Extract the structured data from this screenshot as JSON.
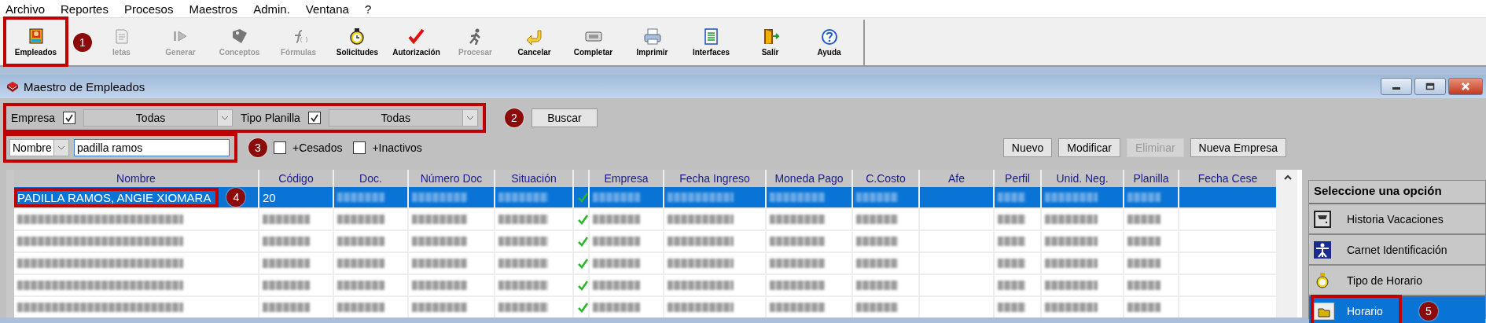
{
  "menu": [
    "Archivo",
    "Reportes",
    "Procesos",
    "Maestros",
    "Admin.",
    "Ventana",
    "?"
  ],
  "toolbar": [
    {
      "label": "Empleados",
      "disabled": false,
      "callout": "1"
    },
    {
      "label": "letas",
      "disabled": true
    },
    {
      "label": "Generar",
      "disabled": true
    },
    {
      "label": "Conceptos",
      "disabled": true
    },
    {
      "label": "Fórmulas",
      "disabled": true
    },
    {
      "label": "Solicitudes",
      "disabled": false
    },
    {
      "label": "Autorización",
      "disabled": false
    },
    {
      "label": "Procesar",
      "disabled": true
    },
    {
      "label": "Cancelar",
      "disabled": false
    },
    {
      "label": "Completar",
      "disabled": false
    },
    {
      "label": "Imprimir",
      "disabled": false
    },
    {
      "label": "Interfaces",
      "disabled": false
    },
    {
      "label": "Salir",
      "disabled": false
    },
    {
      "label": "Ayuda",
      "disabled": false
    }
  ],
  "window": {
    "title": "Maestro de Empleados"
  },
  "filters": {
    "callout": "2",
    "empresa": {
      "label": "Empresa",
      "checked": true,
      "value": "Todas"
    },
    "tipo_planilla": {
      "label": "Tipo Planilla",
      "checked": true,
      "value": "Todas"
    },
    "search_button": "Buscar"
  },
  "search": {
    "callout": "3",
    "field": "Nombre",
    "value": "padilla ramos",
    "options": [
      {
        "label": "+Cesados",
        "checked": false
      },
      {
        "label": "+Inactivos",
        "checked": false
      }
    ]
  },
  "actions": [
    {
      "label": "Nuevo",
      "disabled": false
    },
    {
      "label": "Modificar",
      "disabled": false
    },
    {
      "label": "Eliminar",
      "disabled": true
    },
    {
      "label": "Nueva Empresa",
      "disabled": false
    }
  ],
  "table": {
    "columns": [
      {
        "kind": "text",
        "label": "Nombre"
      },
      {
        "kind": "text",
        "label": "Código"
      },
      {
        "kind": "text",
        "label": "Doc."
      },
      {
        "kind": "text",
        "label": "Número Doc"
      },
      {
        "kind": "text",
        "label": "Situación"
      },
      {
        "kind": "status"
      },
      {
        "kind": "text",
        "label": "Empresa"
      },
      {
        "kind": "text",
        "label": "Fecha Ingreso"
      },
      {
        "kind": "text",
        "label": "Moneda Pago"
      },
      {
        "kind": "text",
        "label": "C.Costo"
      },
      {
        "kind": "text",
        "label": "Afe"
      },
      {
        "kind": "text",
        "label": "Perfil"
      },
      {
        "kind": "text",
        "label": "Unid. Neg."
      },
      {
        "kind": "text",
        "label": "Planilla"
      },
      {
        "kind": "text",
        "label": "Fecha Cese"
      }
    ],
    "rows": [
      {
        "selected": true,
        "cells": [
          {
            "kind": "text",
            "text": "PADILLA RAMOS, ANGIE XIOMARA",
            "callout": "4"
          },
          {
            "kind": "text",
            "text": "20"
          },
          {
            "kind": "blurred"
          },
          {
            "kind": "blurred"
          },
          {
            "kind": "blurred"
          },
          {
            "kind": "check",
            "checked": true
          },
          {
            "kind": "blurred"
          },
          {
            "kind": "blurred"
          },
          {
            "kind": "blurred"
          },
          {
            "kind": "blurred"
          },
          {
            "kind": "empty"
          },
          {
            "kind": "blurred"
          },
          {
            "kind": "blurred"
          },
          {
            "kind": "blurred"
          },
          {
            "kind": "empty"
          }
        ]
      },
      {
        "selected": false,
        "cells": [
          {
            "kind": "blurred"
          },
          {
            "kind": "blurred"
          },
          {
            "kind": "blurred"
          },
          {
            "kind": "blurred"
          },
          {
            "kind": "blurred"
          },
          {
            "kind": "check",
            "checked": true
          },
          {
            "kind": "blurred"
          },
          {
            "kind": "blurred"
          },
          {
            "kind": "blurred"
          },
          {
            "kind": "blurred"
          },
          {
            "kind": "empty"
          },
          {
            "kind": "blurred"
          },
          {
            "kind": "blurred"
          },
          {
            "kind": "blurred"
          },
          {
            "kind": "empty"
          }
        ]
      },
      {
        "selected": false,
        "cells": [
          {
            "kind": "blurred"
          },
          {
            "kind": "blurred"
          },
          {
            "kind": "blurred"
          },
          {
            "kind": "blurred"
          },
          {
            "kind": "blurred"
          },
          {
            "kind": "check",
            "checked": true
          },
          {
            "kind": "blurred"
          },
          {
            "kind": "blurred"
          },
          {
            "kind": "blurred"
          },
          {
            "kind": "blurred"
          },
          {
            "kind": "empty"
          },
          {
            "kind": "blurred"
          },
          {
            "kind": "blurred"
          },
          {
            "kind": "blurred"
          },
          {
            "kind": "empty"
          }
        ]
      },
      {
        "selected": false,
        "cells": [
          {
            "kind": "blurred"
          },
          {
            "kind": "blurred"
          },
          {
            "kind": "blurred"
          },
          {
            "kind": "blurred"
          },
          {
            "kind": "blurred"
          },
          {
            "kind": "check",
            "checked": true
          },
          {
            "kind": "blurred"
          },
          {
            "kind": "blurred"
          },
          {
            "kind": "blurred"
          },
          {
            "kind": "blurred"
          },
          {
            "kind": "empty"
          },
          {
            "kind": "blurred"
          },
          {
            "kind": "blurred"
          },
          {
            "kind": "blurred"
          },
          {
            "kind": "empty"
          }
        ]
      },
      {
        "selected": false,
        "cells": [
          {
            "kind": "blurred"
          },
          {
            "kind": "blurred"
          },
          {
            "kind": "blurred"
          },
          {
            "kind": "blurred"
          },
          {
            "kind": "blurred"
          },
          {
            "kind": "check",
            "checked": true
          },
          {
            "kind": "blurred"
          },
          {
            "kind": "blurred"
          },
          {
            "kind": "blurred"
          },
          {
            "kind": "blurred"
          },
          {
            "kind": "empty"
          },
          {
            "kind": "blurred"
          },
          {
            "kind": "blurred"
          },
          {
            "kind": "blurred"
          },
          {
            "kind": "empty"
          }
        ]
      },
      {
        "selected": false,
        "cells": [
          {
            "kind": "blurred"
          },
          {
            "kind": "blurred"
          },
          {
            "kind": "blurred"
          },
          {
            "kind": "blurred"
          },
          {
            "kind": "blurred"
          },
          {
            "kind": "check",
            "checked": true
          },
          {
            "kind": "blurred"
          },
          {
            "kind": "blurred"
          },
          {
            "kind": "blurred"
          },
          {
            "kind": "blurred"
          },
          {
            "kind": "empty"
          },
          {
            "kind": "blurred"
          },
          {
            "kind": "blurred"
          },
          {
            "kind": "blurred"
          },
          {
            "kind": "empty"
          }
        ]
      }
    ]
  },
  "side_panel": {
    "title": "Seleccione una opción",
    "options": [
      {
        "label": "Historia Vacaciones",
        "selected": false
      },
      {
        "label": "Carnet Identificación",
        "selected": false
      },
      {
        "label": "Tipo de Horario",
        "selected": false
      },
      {
        "label": "Horario",
        "selected": true,
        "callout": "5"
      }
    ]
  }
}
